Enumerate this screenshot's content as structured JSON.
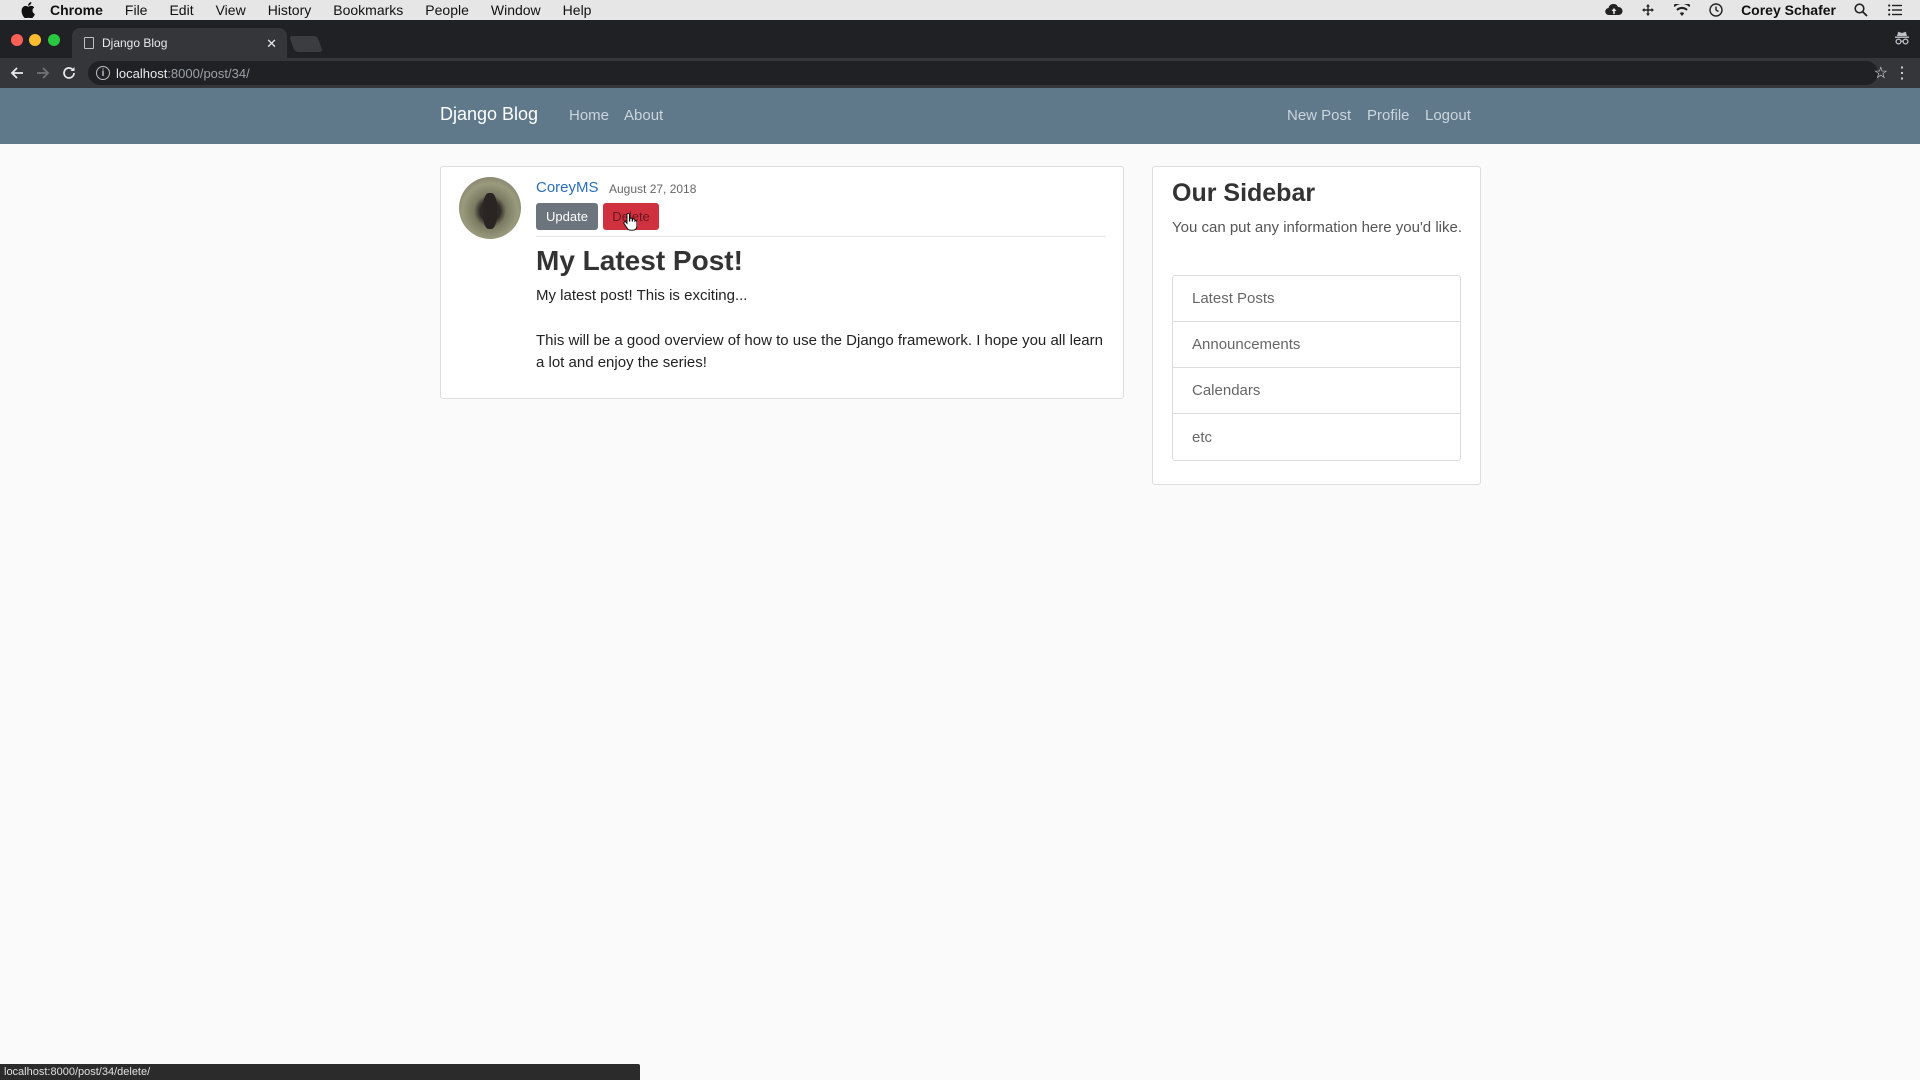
{
  "menubar": {
    "app_name": "Chrome",
    "items": [
      "File",
      "Edit",
      "View",
      "History",
      "Bookmarks",
      "People",
      "Window",
      "Help"
    ],
    "user": "Corey Schafer"
  },
  "browser": {
    "tab_title": "Django Blog",
    "url_host": "localhost",
    "url_path": ":8000/post/34/",
    "status_url": "localhost:8000/post/34/delete/"
  },
  "navbar": {
    "brand": "Django Blog",
    "left_links": [
      "Home",
      "About"
    ],
    "right_links": [
      "New Post",
      "Profile",
      "Logout"
    ],
    "bg_color": "#5f788a"
  },
  "post": {
    "author": "CoreyMS",
    "date": "August 27, 2018",
    "update_label": "Update",
    "delete_label": "Delete",
    "title": "My Latest Post!",
    "paragraphs": [
      "My latest post! This is exciting...",
      "This will be a good overview of how to use the Django framework. I hope you all learn a lot and enjoy the series!"
    ]
  },
  "sidebar": {
    "title": "Our Sidebar",
    "text": "You can put any information here you'd like.",
    "items": [
      "Latest Posts",
      "Announcements",
      "Calendars",
      "etc"
    ]
  }
}
